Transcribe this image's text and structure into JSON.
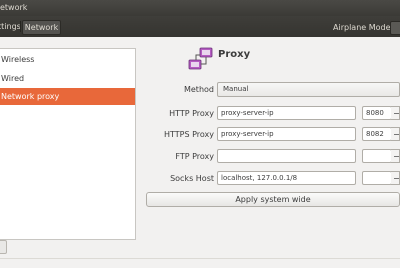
{
  "window": {
    "title": "Network"
  },
  "toolbar": {
    "prev_crumb": "ttings",
    "current_crumb": "Network",
    "airplane_label": "Airplane Mode"
  },
  "sidebar": {
    "items": [
      {
        "label": "Wireless"
      },
      {
        "label": "Wired"
      },
      {
        "label": "Network proxy",
        "selected": true
      }
    ]
  },
  "panel": {
    "title": "Proxy",
    "icon": "proxy-network-icon",
    "method_label": "Method",
    "method_value": "Manual",
    "http_label": "HTTP Proxy",
    "http_host": "proxy-server-ip",
    "http_port": "8080",
    "https_label": "HTTPS Proxy",
    "https_host": "proxy-server-ip",
    "https_port": "8082",
    "ftp_label": "FTP Proxy",
    "ftp_host": "",
    "ftp_port": "",
    "socks_label": "Socks Host",
    "socks_host": "localhost, 127.0.0.1/8",
    "socks_port": "",
    "apply_label": "Apply system wide"
  },
  "colors": {
    "accent": "#e8683a",
    "titlebar": "#3b3a36",
    "background": "#f2f1f0"
  }
}
